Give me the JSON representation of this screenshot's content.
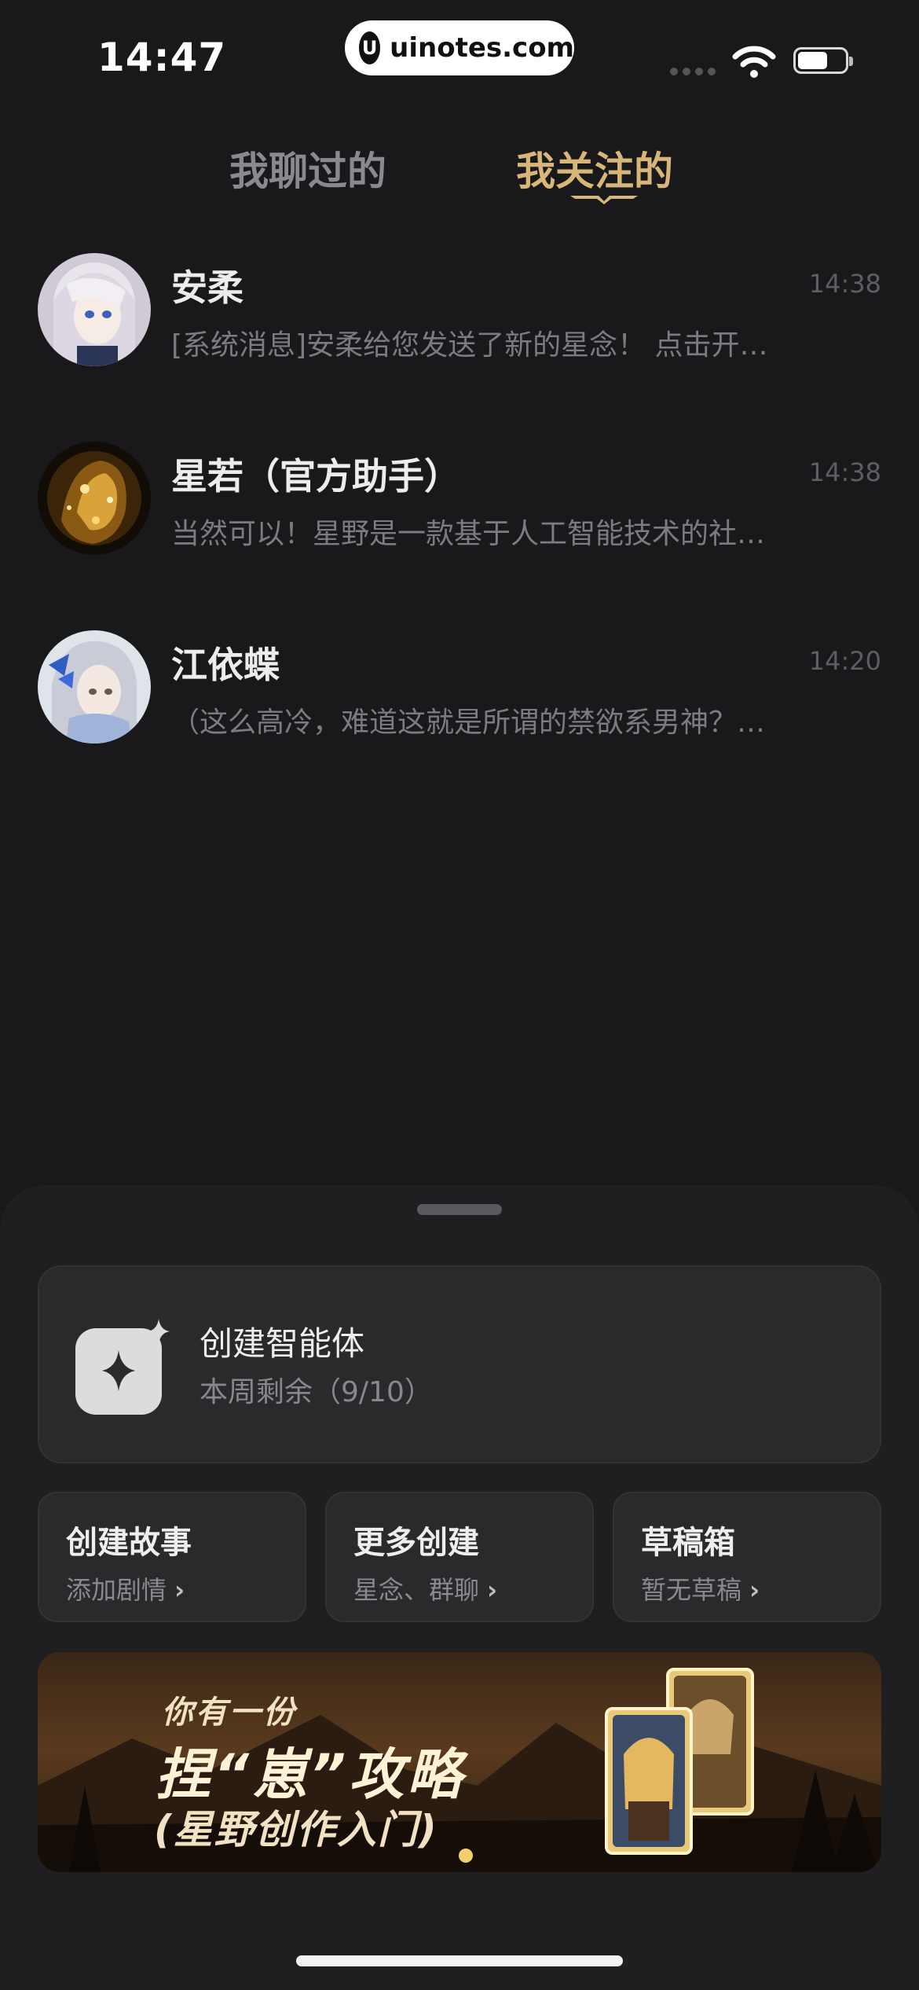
{
  "status_bar": {
    "time": "14:47",
    "watermark": "uinotes.com",
    "watermark_logo": "U"
  },
  "tabs": [
    {
      "label": "我聊过的",
      "active": false
    },
    {
      "label": "我关注的",
      "active": true
    }
  ],
  "chats": [
    {
      "name": "安柔",
      "time": "14:38",
      "message": "[系统消息]安柔给您发送了新的星念！ 点击开…",
      "avatar": "white-haired-anime-girl"
    },
    {
      "name": "星若（官方助手）",
      "time": "14:38",
      "message": "当然可以！星野是一款基于人工智能技术的社…",
      "avatar": "golden-sparkle-figure"
    },
    {
      "name": "江依蝶",
      "time": "14:20",
      "message": "（这么高冷，难道这就是所谓的禁欲系男神？…",
      "avatar": "silver-haired-girl-blue-bow"
    }
  ],
  "sheet": {
    "create_agent": {
      "title": "创建智能体",
      "subtitle": "本周剩余（9/10）",
      "icon": "sparkle-icon"
    },
    "cards": [
      {
        "title": "创建故事",
        "subtitle": "添加剧情"
      },
      {
        "title": "更多创建",
        "subtitle": "星念、群聊"
      },
      {
        "title": "草稿箱",
        "subtitle": "暂无草稿"
      }
    ],
    "banner": {
      "line1": "你有一份",
      "line2": "捏“崽”攻略",
      "line3": "(星野创作入门)"
    }
  },
  "colors": {
    "accent_gold": "#d8b678",
    "background": "#19191b",
    "card": "#2a2a2c"
  }
}
